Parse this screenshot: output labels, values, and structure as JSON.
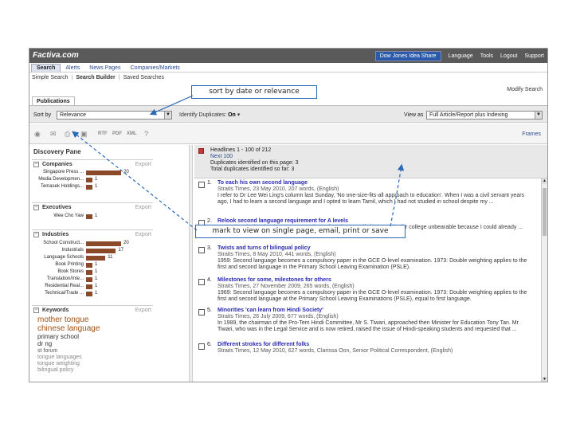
{
  "app": {
    "logo": "Factiva.com",
    "top_links": [
      "Language",
      "Tools",
      "Logout",
      "Support"
    ],
    "idea_share": "Dow Jones Idea Share"
  },
  "tabs": [
    "Search",
    "Alerts",
    "News Pages",
    "Companies/Markets"
  ],
  "subtabs": [
    "Simple Search",
    "Search Builder",
    "Saved Searches"
  ],
  "modify_search": "Modify Search",
  "publications_tab": "Publications",
  "sort": {
    "label": "Sort by",
    "value": "Relevance"
  },
  "identify": {
    "label": "Identify Duplicates:",
    "value": "On"
  },
  "view_as": {
    "label": "View as",
    "value": "Full Article/Report plus Indexing"
  },
  "toolbar": {
    "rtf": "RTF",
    "pdf": "PDF",
    "xml": "XML",
    "frames": "Frames"
  },
  "discovery": {
    "title": "Discovery Pane",
    "companies": {
      "label": "Companies",
      "export": "Export",
      "rows": [
        {
          "name": "Singapore Press ...",
          "count": "20",
          "value": 20
        },
        {
          "name": "Media Developmen...",
          "count": "1",
          "value": 1
        },
        {
          "name": "Temasek Holdings...",
          "count": "1",
          "value": 1
        }
      ]
    },
    "executives": {
      "label": "Executives",
      "export": "Export",
      "rows": [
        {
          "name": "Wee Cho Yaw",
          "count": "1",
          "value": 1
        }
      ]
    },
    "industries": {
      "label": "Industries",
      "export": "Export",
      "rows": [
        {
          "name": "School Construct...",
          "count": "20",
          "value": 20
        },
        {
          "name": "Industrials",
          "count": "17",
          "value": 17
        },
        {
          "name": "Language Schools",
          "count": "11",
          "value": 11
        },
        {
          "name": "Book Printing",
          "count": "1",
          "value": 1
        },
        {
          "name": "Book Stores",
          "count": "1",
          "value": 1
        },
        {
          "name": "Translation/Inte...",
          "count": "1",
          "value": 1
        },
        {
          "name": "Residential Real...",
          "count": "1",
          "value": 1
        },
        {
          "name": "Technical/Trade ...",
          "count": "1",
          "value": 1
        }
      ]
    },
    "keywords": {
      "label": "Keywords",
      "export": "Export",
      "items": [
        {
          "text": "mother tongue",
          "color": "#a05010"
        },
        {
          "text": "chinese language",
          "color": "#a05010"
        },
        {
          "text": "primary school",
          "color": "#333333"
        },
        {
          "text": "dr ng",
          "color": "#333333"
        },
        {
          "text": "st forum",
          "color": "#555555"
        },
        {
          "text": "tongue languages",
          "color": "#888888"
        },
        {
          "text": "tongue weighting",
          "color": "#888888"
        },
        {
          "text": "bilingual policy",
          "color": "#888888"
        }
      ]
    }
  },
  "results_header": {
    "headlines": "Headlines 1 - 100 of 212",
    "next": "Next 100",
    "dup_page": "Duplicates identified on this page: 3",
    "total_dup": "Total duplicates identified so far: 3"
  },
  "results": [
    {
      "n": "1.",
      "title": "To each his own second language",
      "src": "Straits Times, 23 May 2010, 207 words, (English)",
      "snippet": "I refer to Dr Lee Wei Ling's column last Sunday, 'No one-size-fits-all approach to education'. When I was a civil servant years ago, I had to learn a second language and I opted to learn Tamil, which I had not studied in school despite my ..."
    },
    {
      "n": "2.",
      "title": "Relook second language requirement for A levels",
      "src": "",
      "snippet": "Pre-University level. When I was a student, I found my Tamil classes at junior college unbearable because I could already ..."
    },
    {
      "n": "3.",
      "title": "Twists and turns of bilingual policy",
      "src": "Straits Times, 8 May 2010, 441 words, (English)",
      "snippet": "1959: Second language becomes a compulsory paper in the GCE O-level examination. 1973: Double weighting applies to the first and second language in the Primary School Leaving Examination (PSLE)."
    },
    {
      "n": "4.",
      "title": "Milestones for some, milestones for others",
      "src": "Straits Times, 27 November 2009, 265 words, (English)",
      "snippet": "1969: Second language becomes a compulsory paper in the GCE O-level examination. 1973: Double weighting applies to the first and second language at the Primary School Leaving Examinations (PSLE), equal to first language."
    },
    {
      "n": "5.",
      "title": "Minorities 'can learn from Hindi Society'",
      "src": "Straits Times, 26 July 2009, 677 words, (English)",
      "snippet": "In 1989, the chairman of the Pro-Tem Hindi Committee, Mr S. Tiwari, approached then Minister for Education Tony Tan. Mr Tiwari, who was in the Legal Service and is now retired, raised the issue of Hindi-speaking students and requested that ..."
    },
    {
      "n": "6.",
      "title": "Different strokes for different folks",
      "src": "Straits Times, 12 May 2010, 627 words, Clarissa Oon, Senior Political Correspondent, (English)",
      "snippet": ""
    }
  ],
  "callouts": {
    "sort": "sort by date or relevance",
    "mark": "mark  to view on single page, email, print or save"
  }
}
